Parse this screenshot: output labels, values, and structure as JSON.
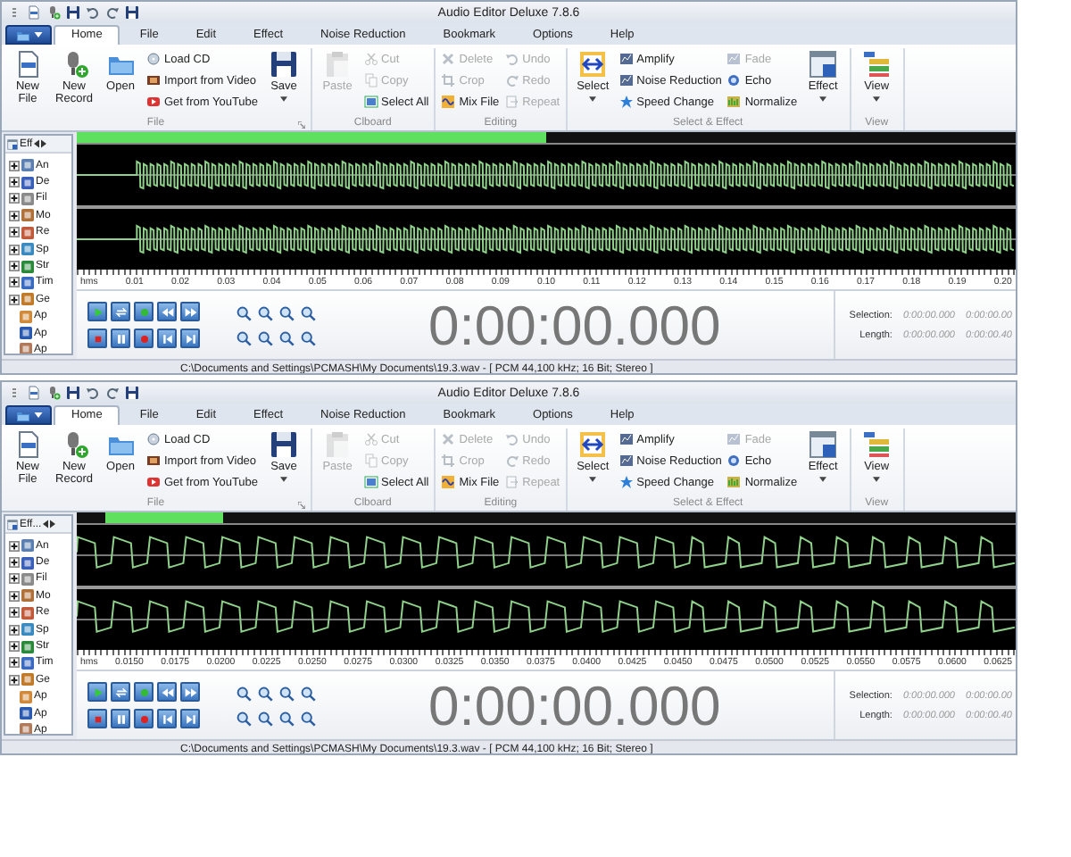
{
  "windows": [
    {
      "title": "Audio Editor Deluxe 7.8.6",
      "tabs": [
        {
          "label": "Home",
          "selected": true
        },
        {
          "label": "File",
          "selected": false
        },
        {
          "label": "Edit",
          "selected": false
        },
        {
          "label": "Effect",
          "selected": false
        },
        {
          "label": "Noise Reduction",
          "selected": false
        },
        {
          "label": "Bookmark",
          "selected": false
        },
        {
          "label": "Options",
          "selected": false
        },
        {
          "label": "Help",
          "selected": false
        }
      ],
      "groups": [
        {
          "label": "File",
          "launcher": true,
          "columns": [
            {
              "kind": "large",
              "label": "New File",
              "disabled": false,
              "dropdown": false
            },
            {
              "kind": "large",
              "label": "New Record",
              "disabled": false,
              "dropdown": false
            },
            {
              "kind": "large",
              "label": "Open",
              "disabled": false,
              "dropdown": false
            },
            {
              "kind": "stack",
              "items": [
                {
                  "label": "Load CD",
                  "disabled": false
                },
                {
                  "label": "Import from Video",
                  "disabled": false
                },
                {
                  "label": "Get from YouTube",
                  "disabled": false
                }
              ]
            },
            {
              "kind": "large",
              "label": "Save",
              "disabled": false,
              "dropdown": true
            }
          ]
        },
        {
          "label": "Clboard",
          "launcher": false,
          "columns": [
            {
              "kind": "large",
              "label": "Paste",
              "disabled": true,
              "dropdown": false
            },
            {
              "kind": "stack",
              "items": [
                {
                  "label": "Cut",
                  "disabled": true
                },
                {
                  "label": "Copy",
                  "disabled": true
                },
                {
                  "label": "Select All",
                  "disabled": false
                }
              ]
            }
          ]
        },
        {
          "label": "Editing",
          "launcher": false,
          "columns": [
            {
              "kind": "stack",
              "items": [
                {
                  "label": "Delete",
                  "disabled": true
                },
                {
                  "label": "Crop",
                  "disabled": true
                },
                {
                  "label": "Mix File",
                  "disabled": false
                }
              ]
            },
            {
              "kind": "stack",
              "items": [
                {
                  "label": "Undo",
                  "disabled": true
                },
                {
                  "label": "Redo",
                  "disabled": true
                },
                {
                  "label": "Repeat",
                  "disabled": true
                }
              ]
            }
          ]
        },
        {
          "label": "Select & Effect",
          "launcher": false,
          "columns": [
            {
              "kind": "large",
              "label": "Select",
              "disabled": false,
              "dropdown": true
            },
            {
              "kind": "stack",
              "items": [
                {
                  "label": "Amplify",
                  "disabled": false
                },
                {
                  "label": "Noise Reduction",
                  "disabled": false
                },
                {
                  "label": "Speed Change",
                  "disabled": false
                }
              ]
            },
            {
              "kind": "stack",
              "items": [
                {
                  "label": "Fade",
                  "disabled": true
                },
                {
                  "label": "Echo",
                  "disabled": false
                },
                {
                  "label": "Normalize",
                  "disabled": false
                }
              ]
            },
            {
              "kind": "large",
              "label": "Effect",
              "disabled": false,
              "dropdown": true
            }
          ]
        },
        {
          "label": "View",
          "launcher": false,
          "columns": [
            {
              "kind": "large",
              "label": "View",
              "disabled": false,
              "dropdown": true
            }
          ]
        }
      ],
      "panel": {
        "header": "Eff",
        "items": [
          {
            "label": "An",
            "kind": "folder",
            "expanded": false
          },
          {
            "label": "De",
            "kind": "folder",
            "expanded": false
          },
          {
            "label": "Fil",
            "kind": "folder",
            "expanded": false
          },
          {
            "label": "Mo",
            "kind": "folder",
            "expanded": false
          },
          {
            "label": "Re",
            "kind": "folder",
            "expanded": false
          },
          {
            "label": "Sp",
            "kind": "folder",
            "expanded": false
          },
          {
            "label": "Str",
            "kind": "folder",
            "expanded": false
          },
          {
            "label": "Tim",
            "kind": "folder",
            "expanded": false
          },
          {
            "label": "Ge",
            "kind": "folder",
            "expanded": false
          },
          {
            "label": "Ap",
            "kind": "leaf"
          },
          {
            "label": "Ap",
            "kind": "leaf"
          },
          {
            "label": "Ap",
            "kind": "leaf"
          }
        ]
      },
      "channels": [
        {
          "kind": "dense"
        },
        {
          "kind": "dense"
        }
      ],
      "ruler": [
        "hms",
        "0.01",
        "0.02",
        "0.03",
        "0.04",
        "0.05",
        "0.06",
        "0.07",
        "0.08",
        "0.09",
        "0.10",
        "0.11",
        "0.12",
        "0.13",
        "0.14",
        "0.15",
        "0.16",
        "0.17",
        "0.18",
        "0.19",
        "0.20"
      ],
      "time": "0:00:00.000",
      "selection": {
        "label": "Selection:",
        "start": "0:00:00.000",
        "end": "0:00:00.00"
      },
      "length": {
        "label": "Length:",
        "start": "0:00:00.000",
        "end": "0:00:00.40"
      },
      "status": "C:\\Documents and Settings\\PCMASH\\My Documents\\19.3.wav - [ PCM 44,100 kHz; 16 Bit; Stereo ]"
    },
    {
      "title": "Audio Editor Deluxe 7.8.6",
      "tabs": [
        {
          "label": "Home",
          "selected": true
        },
        {
          "label": "File",
          "selected": false
        },
        {
          "label": "Edit",
          "selected": false
        },
        {
          "label": "Effect",
          "selected": false
        },
        {
          "label": "Noise Reduction",
          "selected": false
        },
        {
          "label": "Bookmark",
          "selected": false
        },
        {
          "label": "Options",
          "selected": false
        },
        {
          "label": "Help",
          "selected": false
        }
      ],
      "groups": [
        {
          "label": "File",
          "launcher": true,
          "columns": [
            {
              "kind": "large",
              "label": "New File",
              "disabled": false,
              "dropdown": false
            },
            {
              "kind": "large",
              "label": "New Record",
              "disabled": false,
              "dropdown": false
            },
            {
              "kind": "large",
              "label": "Open",
              "disabled": false,
              "dropdown": false
            },
            {
              "kind": "stack",
              "items": [
                {
                  "label": "Load CD",
                  "disabled": false
                },
                {
                  "label": "Import from Video",
                  "disabled": false
                },
                {
                  "label": "Get from YouTube",
                  "disabled": false
                }
              ]
            },
            {
              "kind": "large",
              "label": "Save",
              "disabled": false,
              "dropdown": true
            }
          ]
        },
        {
          "label": "Clboard",
          "launcher": false,
          "columns": [
            {
              "kind": "large",
              "label": "Paste",
              "disabled": true,
              "dropdown": false
            },
            {
              "kind": "stack",
              "items": [
                {
                  "label": "Cut",
                  "disabled": true
                },
                {
                  "label": "Copy",
                  "disabled": true
                },
                {
                  "label": "Select All",
                  "disabled": false
                }
              ]
            }
          ]
        },
        {
          "label": "Editing",
          "launcher": false,
          "columns": [
            {
              "kind": "stack",
              "items": [
                {
                  "label": "Delete",
                  "disabled": true
                },
                {
                  "label": "Crop",
                  "disabled": true
                },
                {
                  "label": "Mix File",
                  "disabled": false
                }
              ]
            },
            {
              "kind": "stack",
              "items": [
                {
                  "label": "Undo",
                  "disabled": true
                },
                {
                  "label": "Redo",
                  "disabled": true
                },
                {
                  "label": "Repeat",
                  "disabled": true
                }
              ]
            }
          ]
        },
        {
          "label": "Select & Effect",
          "launcher": false,
          "columns": [
            {
              "kind": "large",
              "label": "Select",
              "disabled": false,
              "dropdown": true
            },
            {
              "kind": "stack",
              "items": [
                {
                  "label": "Amplify",
                  "disabled": false
                },
                {
                  "label": "Noise Reduction",
                  "disabled": false
                },
                {
                  "label": "Speed Change",
                  "disabled": false
                }
              ]
            },
            {
              "kind": "stack",
              "items": [
                {
                  "label": "Fade",
                  "disabled": true
                },
                {
                  "label": "Echo",
                  "disabled": false
                },
                {
                  "label": "Normalize",
                  "disabled": false
                }
              ]
            },
            {
              "kind": "large",
              "label": "Effect",
              "disabled": false,
              "dropdown": true
            }
          ]
        },
        {
          "label": "View",
          "launcher": false,
          "columns": [
            {
              "kind": "large",
              "label": "View",
              "disabled": false,
              "dropdown": true
            }
          ]
        }
      ],
      "panel": {
        "header": "Eff...",
        "items": [
          {
            "label": "An",
            "kind": "folder",
            "expanded": false
          },
          {
            "label": "De",
            "kind": "folder",
            "expanded": false
          },
          {
            "label": "Fil",
            "kind": "folder",
            "expanded": false
          },
          {
            "label": "Mo",
            "kind": "folder",
            "expanded": false
          },
          {
            "label": "Re",
            "kind": "folder",
            "expanded": false
          },
          {
            "label": "Sp",
            "kind": "folder",
            "expanded": false
          },
          {
            "label": "Str",
            "kind": "folder",
            "expanded": false
          },
          {
            "label": "Tim",
            "kind": "folder",
            "expanded": false
          },
          {
            "label": "Ge",
            "kind": "folder",
            "expanded": false
          },
          {
            "label": "Ap",
            "kind": "leaf"
          },
          {
            "label": "Ap",
            "kind": "leaf"
          },
          {
            "label": "Ap",
            "kind": "leaf"
          }
        ]
      },
      "channels": [
        {
          "kind": "square"
        },
        {
          "kind": "square"
        }
      ],
      "ruler": [
        "hms",
        "0.0150",
        "0.0175",
        "0.0200",
        "0.0225",
        "0.0250",
        "0.0275",
        "0.0300",
        "0.0325",
        "0.0350",
        "0.0375",
        "0.0400",
        "0.0425",
        "0.0450",
        "0.0475",
        "0.0500",
        "0.0525",
        "0.0550",
        "0.0575",
        "0.0600",
        "0.0625"
      ],
      "time": "0:00:00.000",
      "selection": {
        "label": "Selection:",
        "start": "0:00:00.000",
        "end": "0:00:00.00"
      },
      "length": {
        "label": "Length:",
        "start": "0:00:00.000",
        "end": "0:00:00.40"
      },
      "status": "C:\\Documents and Settings\\PCMASH\\My Documents\\19.3.wav - [ PCM 44,100 kHz; 16 Bit; Stereo ]"
    }
  ]
}
